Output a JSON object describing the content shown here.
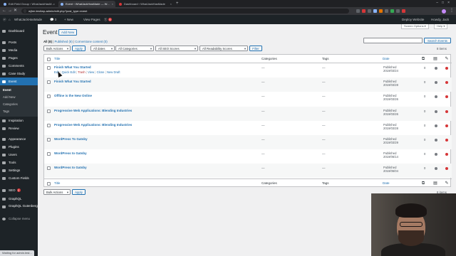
{
  "browser": {
    "tabs": [
      {
        "title": "Edit Field Group ‹ WhatJackHasM...",
        "active": false
      },
      {
        "title": "Event ‹ WhatJackHasMade — W...",
        "active": true
      },
      {
        "title": "Dashboard ‹ WhatJackHasMade",
        "active": false
      }
    ],
    "new_tab": "+",
    "url": "wjhm.test/wp-admin/edit.php?post_type=event",
    "status_text": "Waiting for admin.test..."
  },
  "admin_bar": {
    "site_name": "WhatJackHasMade",
    "comments_count": "0",
    "new_label": "New",
    "view_pages": "View Pages",
    "updates_count": "5",
    "deploy": "Deploy Website",
    "howdy": "Howdy, Jack"
  },
  "sidebar": {
    "items": [
      {
        "label": "Dashboard",
        "icon": "dashboard-icon"
      },
      {
        "label": "Posts",
        "icon": "pin-icon"
      },
      {
        "label": "Media",
        "icon": "media-icon"
      },
      {
        "label": "Pages",
        "icon": "page-icon"
      },
      {
        "label": "Comments",
        "icon": "comment-icon"
      },
      {
        "label": "Case Study",
        "icon": "case-study-icon"
      },
      {
        "label": "Event",
        "icon": "event-icon"
      },
      {
        "label": "Inspiration",
        "icon": "inspiration-icon"
      },
      {
        "label": "Review",
        "icon": "review-icon"
      },
      {
        "label": "Appearance",
        "icon": "appearance-icon"
      },
      {
        "label": "Plugins",
        "icon": "plugins-icon"
      },
      {
        "label": "Users",
        "icon": "users-icon"
      },
      {
        "label": "Tools",
        "icon": "tools-icon"
      },
      {
        "label": "Settings",
        "icon": "settings-icon"
      },
      {
        "label": "Custom Fields",
        "icon": "custom-fields-icon"
      },
      {
        "label": "SEO",
        "icon": "seo-icon",
        "badge": "2"
      },
      {
        "label": "GraphQL",
        "icon": "graphql-icon"
      },
      {
        "label": "GraphQL Gutenberg",
        "icon": "graphql-gutenberg-icon"
      },
      {
        "label": "Collapse menu",
        "icon": "collapse-icon"
      }
    ],
    "submenu": [
      "Event",
      "Add New",
      "Categories",
      "Tags"
    ]
  },
  "page": {
    "title": "Event",
    "add_new": "Add New",
    "screen_options": "Screen Options ▾",
    "help": "Help ▾",
    "views": {
      "all": "All (8)",
      "published": "Published (8)",
      "cornerstone": "Cornerstone content (0)"
    },
    "search_button": "Search Events",
    "bulk_actions": "Bulk Actions",
    "apply": "Apply",
    "all_dates": "All dates",
    "all_categories": "All Categories",
    "all_seo": "All SEO Scores",
    "all_readability": "All Readability Scores",
    "filter": "Filter",
    "items_count": "8 items"
  },
  "table": {
    "columns": {
      "title": "Title",
      "categories": "Categories",
      "tags": "Tags",
      "date": "Date"
    },
    "row_actions": {
      "edit": "Edit",
      "quick_edit": "Quick Edit",
      "trash": "Trash",
      "view": "View",
      "clone": "Clone",
      "new_draft": "New Draft"
    },
    "rows": [
      {
        "title": "Finish What You Started",
        "categories": "—",
        "tags": "—",
        "status": "Published",
        "date": "2019/03/24",
        "links": "0",
        "seo_color": "#787c82",
        "read_color": "#d63638"
      },
      {
        "title": "Finish What You Started",
        "categories": "—",
        "tags": "—",
        "status": "Published",
        "date": "2019/03/28",
        "links": "0",
        "seo_color": "#787c82",
        "read_color": "#d63638"
      },
      {
        "title": "Offline is the New Online",
        "categories": "—",
        "tags": "—",
        "status": "Published",
        "date": "2019/03/26",
        "links": "0",
        "seo_color": "#787c82",
        "read_color": "#d63638"
      },
      {
        "title": "Progressive Web Applications: Blending Industries",
        "categories": "—",
        "tags": "—",
        "status": "Published",
        "date": "2019/03/26",
        "links": "0",
        "seo_color": "#787c82",
        "read_color": "#d63638"
      },
      {
        "title": "Progressive Web Applications: Blending Industries",
        "categories": "—",
        "tags": "—",
        "status": "Published",
        "date": "2019/03/28",
        "links": "0",
        "seo_color": "#787c82",
        "read_color": "#d63638"
      },
      {
        "title": "WordPress To Gatsby",
        "categories": "—",
        "tags": "—",
        "status": "Published",
        "date": "2019/03/29",
        "links": "0",
        "seo_color": "#787c82",
        "read_color": "#d63638"
      },
      {
        "title": "WordPress to Gatsby",
        "categories": "—",
        "tags": "—",
        "status": "Published",
        "date": "2019/06/14",
        "links": "0",
        "seo_color": "#787c82",
        "read_color": "#d63638"
      },
      {
        "title": "WordPress to Gatsby",
        "categories": "—",
        "tags": "—",
        "status": "Published",
        "date": "2019/06/04",
        "links": "0",
        "seo_color": "#787c82",
        "read_color": "#d63638"
      }
    ]
  },
  "colors": {
    "accent": "#2271b1",
    "admin_dark": "#1d2327",
    "danger": "#d63638"
  }
}
